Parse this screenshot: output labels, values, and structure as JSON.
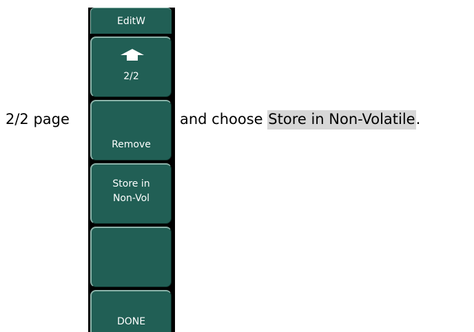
{
  "caption": {
    "prefix": "2/2 page",
    "middle": "and choose ",
    "highlight": "Store in Non-Volatile",
    "suffix": "."
  },
  "menu": {
    "title": "EditW",
    "page_indicator": "2/2",
    "keys": {
      "remove": "Remove",
      "store_line1": "Store in",
      "store_line2": "Non-Vol",
      "empty": "",
      "done": "DONE"
    }
  },
  "colors": {
    "softkey_fill": "#215f55",
    "softkey_highlight": "#8cb4aa",
    "panel_background": "#000000",
    "caption_highlight": "#d7d7d7"
  },
  "icons": {
    "page_up": "up-arrow-icon"
  }
}
